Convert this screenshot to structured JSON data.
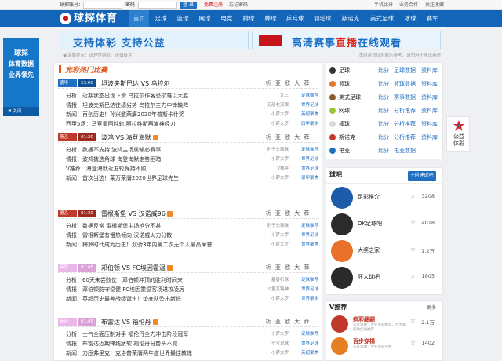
{
  "topbar": {
    "account_label": "球探账号：",
    "password_label": "密码：",
    "login": "登 录",
    "register": "免费注册",
    "forgot": "忘记密码",
    "mobile": "手机比分",
    "business": "业务合作",
    "favorite": "关注收藏"
  },
  "header": {
    "logo": "球探体育",
    "nav": [
      "首页",
      "足球",
      "篮球",
      "网球",
      "电竞",
      "排球",
      "棒球",
      "乒乓球",
      "羽毛球",
      "斯诺克",
      "美式足球",
      "冰球",
      "赛车"
    ]
  },
  "banners": {
    "left": "支持体彩  支持公益",
    "right_prefix": "高清赛事",
    "right_highlight": "直播",
    "right_suffix": "在线观看"
  },
  "notice": {
    "left": "◀ 温馨提示：请理性购彩、谨慎投注",
    "right": "本网资讯仅供娱乐参考，请勿用于非法用途"
  },
  "left_ad": {
    "line1": "球探",
    "line2": "体育数据",
    "line3": "业界领先",
    "close": "关闭"
  },
  "right_ad": {
    "line1": "公益",
    "line2": "体彩"
  },
  "main": {
    "section_title": "竞彩热门比赛",
    "matches": [
      {
        "tag": "德甲",
        "tag_color": "#1f6fc2",
        "time": "23:00",
        "name": "坦波夫斯巴达 VS 乌拉尔",
        "hot": false,
        "links": "析 亚 欧 大 荐",
        "rows": [
          {
            "c": "分析：近期状态出现下滑 乌拉尔作客恐损难以大胜",
            "a": "九三",
            "s": "足球推荐"
          },
          {
            "c": "情报：坦波夫斯巴达往绩劣势 乌拉尔主力中锋缺阵",
            "a": "无敌老流氓",
            "s": "世界足球"
          },
          {
            "c": "新闻：再创历史！孙兴慜荣膺2020年普斯卡什奖",
            "a": "小萨大罗",
            "s": "英超聚焦"
          },
          {
            "c": "西甲5场：马竞重回胜轨 阿拉维斯再演神经刀",
            "a": "小萨大罗",
            "s": "西甲聚焦"
          }
        ]
      },
      {
        "tag": "俄乙",
        "tag_color": "#c03a2b",
        "time": "01:30",
        "name": "波鸿 VS 海登海默",
        "hot": true,
        "links": "析 亚 欧 大 荐",
        "rows": [
          {
            "c": "分析：数据不支持 波鸿主场属輸必赛事",
            "a": "豹子头球球",
            "s": "足球推荐"
          },
          {
            "c": "情报：波鸿搪选角球 海登海默走势困暗",
            "a": "小萨大罗",
            "s": "世界足球"
          },
          {
            "c": "V推荐：海登海默近五轮保持不败",
            "a": "V推荐",
            "s": "世界足球"
          },
          {
            "c": "新闻：首次当选！莱万荣膺2020世界足球先生",
            "a": "小萨大罗",
            "s": "德甲聚焦"
          }
        ]
      },
      {
        "tag": "德乙",
        "tag_color": "#c03a2b",
        "time": "01:30",
        "name": "雷根斯堡 VS 汉诺威96",
        "hot": true,
        "links": "析 亚 欧 大 荐",
        "rows": [
          {
            "c": "分析：数据反常 雷根斯堡主场抢分不甚",
            "a": "豹子头球球",
            "s": "足球推荐"
          },
          {
            "c": "情报：雷根斯堡有慢热倾向 汉诺威火力分散",
            "a": "小萨大罗",
            "s": "世界足球"
          },
          {
            "c": "新闻：梅罗时代成为历史！双骄3年内第二次无个人最高荣誉",
            "a": "小萨大罗",
            "s": "世界聚焦"
          }
        ]
      },
      {
        "tag": "英冠",
        "tag_color": "#e9b8e8",
        "time": "01:45",
        "name": "邓伯顿 VS FC埃因霍温",
        "hot": true,
        "links": "析 亚 欧 大 荐",
        "rows": [
          {
            "c": "分析：60天未尝败仗！邓伯顿冲顶的胜利时间来",
            "a": "基香析球",
            "s": "足球推荐"
          },
          {
            "c": "情报：邓伯顿防守稳健 FC埃因霍温客场进攻凌厉",
            "a": "10里克路神",
            "s": "世界足球"
          },
          {
            "c": "新闻：英超历史最差战绩诞生！垫底队坠出新低",
            "a": "小萨大罗",
            "s": "世界聚焦"
          }
        ]
      },
      {
        "tag": "英冠",
        "tag_color": "#e9b8e8",
        "time": "01:45",
        "name": "布雷达 VS 福伦丹",
        "hot": true,
        "links": "析 亚 欧 大 荐",
        "rows": [
          {
            "c": "分析：士气全面压制对手 福伦丹全力冲击阶段冠军",
            "a": "小萨大罗",
            "s": "足球推荐"
          },
          {
            "c": "情报：布雷达近期锋线疲软 福伦丹分势头不减",
            "a": "七宝说球",
            "s": "世界足球"
          },
          {
            "c": "新闻：力压弗里克！克洛普荣膺两年度世界最佳教练",
            "a": "小萨大罗",
            "s": "英超聚焦"
          }
        ]
      }
    ]
  },
  "sports": [
    {
      "name": "足球",
      "color": "#333",
      "l1": "比分",
      "l2": "足球数据",
      "l3": "资料库"
    },
    {
      "name": "篮球",
      "color": "#e6782a",
      "l1": "比分",
      "l2": "篮球数据",
      "l3": "资料库"
    },
    {
      "name": "美式足球",
      "color": "#8b5a2b",
      "l1": "比分",
      "l2": "赛事数据",
      "l3": "资料库"
    },
    {
      "name": "网球",
      "color": "#9cc43a",
      "l1": "比分",
      "l2": "分析推荐",
      "l3": "资料库"
    },
    {
      "name": "棒球",
      "color": "#d9d9d9",
      "l1": "比分",
      "l2": "分析推荐",
      "l3": "资料库"
    },
    {
      "name": "斯诺克",
      "color": "#c0392b",
      "l1": "比分",
      "l2": "分析推荐",
      "l3": "资料库"
    },
    {
      "name": "电竞",
      "color": "#1f6fc2",
      "l1": "比分",
      "l2": "电竞数据",
      "l3": ""
    }
  ],
  "tieba": {
    "title": "球吧",
    "create": "+创建球吧",
    "items": [
      {
        "name": "足彩推介",
        "count": "3208",
        "av": "#1e5ba8"
      },
      {
        "name": "OK足球吧",
        "count": "4018",
        "av": "#2b2b2b"
      },
      {
        "name": "大奖之家",
        "count": "1.2万",
        "av": "#e8722a"
      },
      {
        "name": "狂人球吧",
        "count": "1805",
        "av": "#2a2a2a"
      }
    ]
  },
  "vrec": {
    "title": "V推荐",
    "more": "更多",
    "items": [
      {
        "name": "疯彩翩翩",
        "desc": "认证说明：专业足彩推荐，为大家提供优质推荐",
        "count": "2.1万",
        "av": "#c0392b"
      },
      {
        "name": "百步穿楊",
        "desc": "认证说明：专业足彩分析",
        "count": "1402",
        "av": "#e67e22"
      }
    ]
  }
}
